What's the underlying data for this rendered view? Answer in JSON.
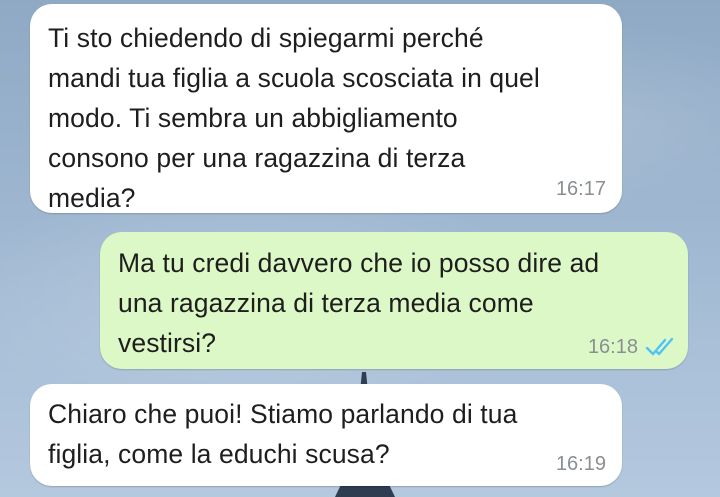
{
  "conversation": {
    "messages": [
      {
        "direction": "incoming",
        "text": "Ti sto chiedendo di spiegarmi perché\nmandi tua figlia a scuola scosciata in quel\nmodo. Ti sembra un abbigliamento\nconsono per una ragazzina di terza\nmedia?",
        "time": "16:17"
      },
      {
        "direction": "outgoing",
        "text": "Ma tu credi davvero che io posso dire ad\nuna ragazzina di terza media come\nvestirsi?",
        "time": "16:18",
        "status_icon": "double-check-read-icon",
        "status_color": "#4fc3f7"
      },
      {
        "direction": "incoming",
        "text": "Chiaro che puoi! Stiamo parlando di tua\nfiglia, come la educhi scusa?",
        "time": "16:19"
      }
    ]
  },
  "colors": {
    "incoming_bubble": "#ffffff",
    "outgoing_bubble": "#dcf8c6",
    "text": "#1e1e1e",
    "timestamp": "#8a8f93"
  }
}
